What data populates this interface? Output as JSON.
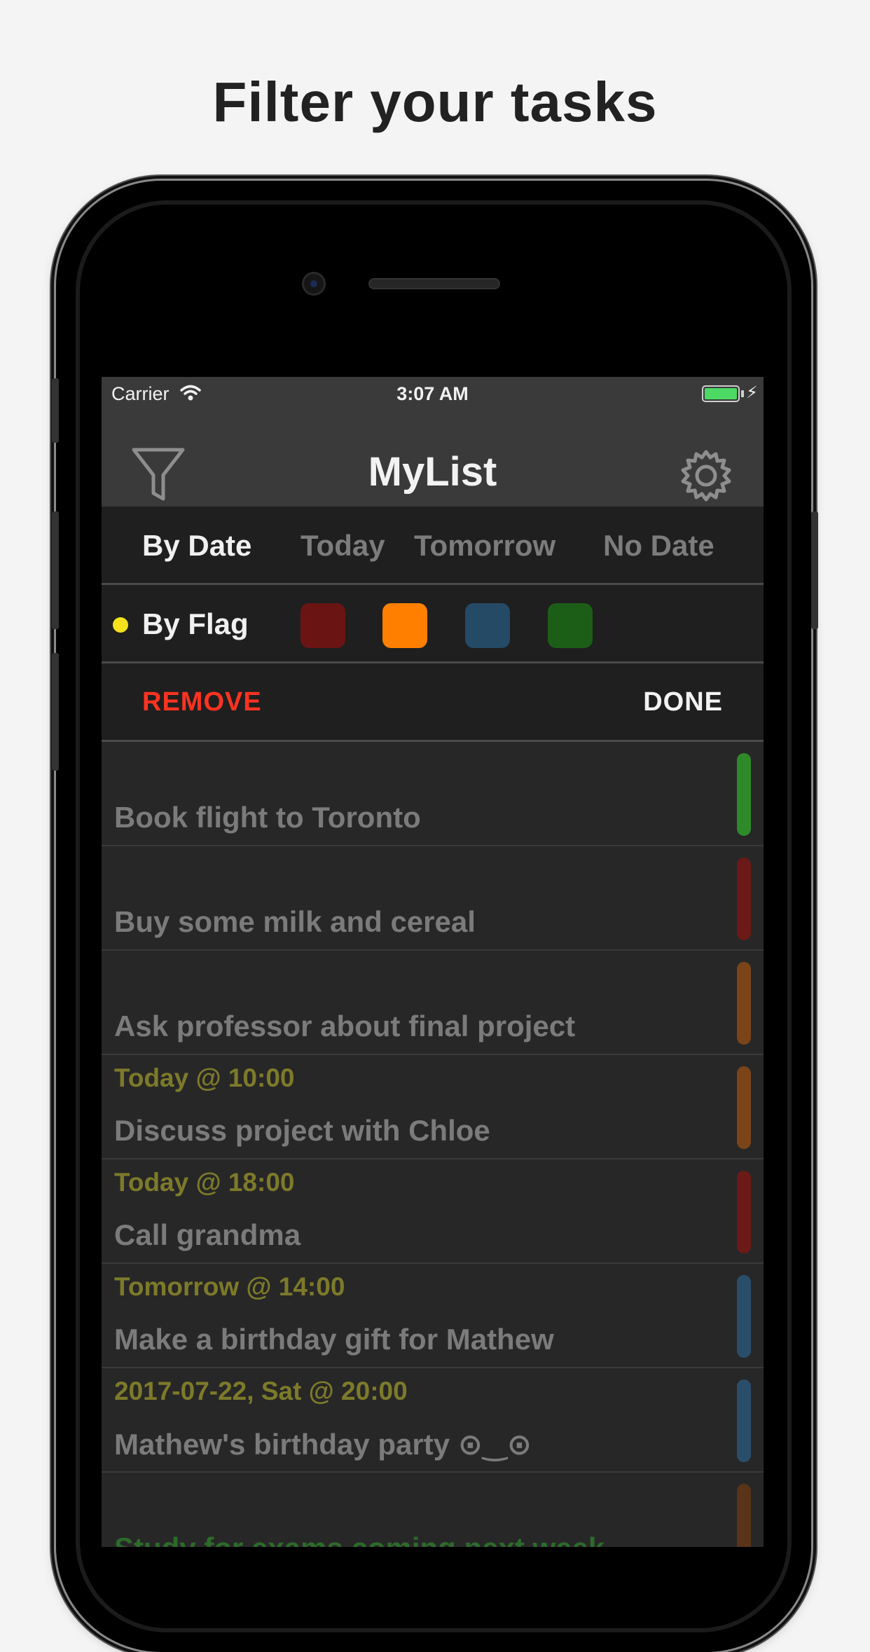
{
  "headline": "Filter your tasks",
  "status_bar": {
    "carrier": "Carrier",
    "time": "3:07 AM"
  },
  "nav": {
    "title": "MyList",
    "left_icon": "filter-icon",
    "right_icon": "gear-icon"
  },
  "date_filter": {
    "label": "By Date",
    "options": [
      "Today",
      "Tomorrow",
      "No Date"
    ]
  },
  "flag_filter": {
    "label": "By Flag",
    "indicator_color": "#f5e11c",
    "colors": [
      "#6b1414",
      "#ff8000",
      "#244a66",
      "#1c5e17"
    ]
  },
  "actions": {
    "remove": "REMOVE",
    "done": "DONE"
  },
  "tasks": [
    {
      "date": "",
      "title": "Book flight to Toronto",
      "flag": "#2e8a29",
      "completed": false
    },
    {
      "date": "",
      "title": "Buy some milk and cereal",
      "flag": "#6b1a18",
      "completed": false
    },
    {
      "date": "",
      "title": "Ask professor about final project",
      "flag": "#7a4418",
      "completed": false
    },
    {
      "date": "Today @ 10:00",
      "title": "Discuss project with Chloe",
      "flag": "#7a4418",
      "completed": false
    },
    {
      "date": "Today @ 18:00",
      "title": "Call grandma",
      "flag": "#6b1a18",
      "completed": false
    },
    {
      "date": "Tomorrow @ 14:00",
      "title": "Make a birthday gift for Mathew",
      "flag": "#2a4e6a",
      "completed": false
    },
    {
      "date": "2017-07-22, Sat @ 20:00",
      "title": "Mathew's birthday party ⊙‿⊙",
      "flag": "#2a4e6a",
      "completed": false
    },
    {
      "date": "",
      "title": "Study for exams coming next week",
      "flag": "#5a3418",
      "completed": true
    }
  ]
}
